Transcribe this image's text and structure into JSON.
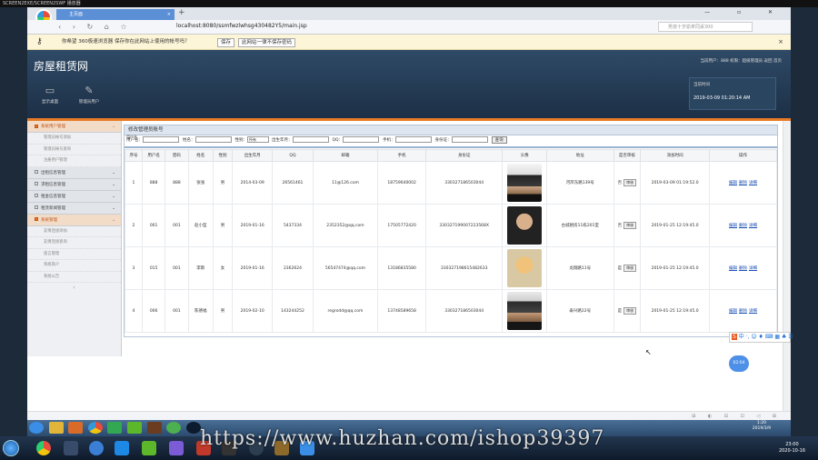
{
  "outer_title": "SCREEN2EXE/SCREEN2SWF 播放器",
  "browser": {
    "tab_label": "主页面",
    "tab_close": "×",
    "new_tab": "+",
    "nav_icons": "‹ › ↻ ⌂ ☆",
    "url": "localhost:8080/ssmfwzlwhsg430482Y5/main.jsp",
    "search_placeholder": "男孩十岁偷拿同桌300",
    "window_controls": "— ▫ ✕"
  },
  "infobar": {
    "text": "你希望 360极速浏览器 保存你在此网站上使用的帐号吗？",
    "save": "保存",
    "never": "此网站一律不保存密码",
    "close": "×"
  },
  "app": {
    "site_name": "房屋租赁网",
    "user_links": "当前用户：888 权限：超级管理员 返回 首页",
    "header_btns": [
      {
        "icon": "▭",
        "label": "显示桌面"
      },
      {
        "icon": "✎",
        "label": "管理员用户"
      }
    ],
    "time_label": "当前时间",
    "time_value": "2019-03-09 01:20:14 AM"
  },
  "sidebar": [
    {
      "label": "系统用户管理",
      "active": true,
      "items": [
        "管理员帐号添加",
        "管理员帐号查询",
        "注册用户管理"
      ]
    },
    {
      "label": "出租信息管理",
      "active": false,
      "items": []
    },
    {
      "label": "求租信息管理",
      "active": false,
      "items": []
    },
    {
      "label": "租金信息管理",
      "active": false,
      "items": []
    },
    {
      "label": "租赁新闻管理",
      "active": false,
      "items": []
    },
    {
      "label": "系统管理",
      "active": true,
      "items": [
        "友情连接添加",
        "友情连接查询",
        "留言管理",
        "系统简介",
        "系统公告"
      ]
    }
  ],
  "sidebar_collapse": "‹",
  "main": {
    "title": "修改管理员账号",
    "page_label": "用户名",
    "filters": [
      {
        "label": "用户名：",
        "type": "input"
      },
      {
        "label": "姓名：",
        "type": "input"
      },
      {
        "label": "性别：",
        "type": "select",
        "value": "所有"
      },
      {
        "label": "出生年月：",
        "type": "input"
      },
      {
        "label": "QQ：",
        "type": "input"
      },
      {
        "label": "手机：",
        "type": "input"
      },
      {
        "label": "身份证：",
        "type": "input"
      }
    ],
    "search_btn": "查询",
    "columns": [
      "序号",
      "用户名",
      "密码",
      "姓名",
      "性别",
      "出生年月",
      "QQ",
      "邮箱",
      "手机",
      "身份证",
      "头像",
      "地址",
      "是否审核",
      "添加时间",
      "操作"
    ],
    "rows": [
      {
        "no": "1",
        "user": "888",
        "pwd": "888",
        "name": "张张",
        "sex": "男",
        "birth": "2014-03-09",
        "qq": "26561461",
        "email": "11@126.com",
        "phone": "18759640002",
        "idcard": "330327186503044",
        "photo": "ph1",
        "addr": "河岸东路139号",
        "audit": "否",
        "time": "2019-03-09 01:19:52.0"
      },
      {
        "no": "2",
        "user": "001",
        "pwd": "001",
        "name": "赵小型",
        "sex": "男",
        "birth": "2019-01-16",
        "qq": "5437334",
        "email": "2352352@qq.com",
        "phone": "17505772420",
        "idcard": "330327199007223568X",
        "photo": "ph2",
        "addr": "古城厨房11栋201室",
        "audit": "否",
        "time": "2019-01-25 12:19:45.0"
      },
      {
        "no": "3",
        "user": "015",
        "pwd": "001",
        "name": "李斯",
        "sex": "女",
        "birth": "2019-01-16",
        "qq": "2362624",
        "email": "56547474@qq.com",
        "phone": "13186835580",
        "idcard": "330327198615482633",
        "photo": "ph3",
        "addr": "龙翔路11号",
        "audit": "是",
        "time": "2019-01-25 12:19:45.0"
      },
      {
        "no": "4",
        "user": "006",
        "pwd": "001",
        "name": "陈德福",
        "sex": "男",
        "birth": "2019-02-10",
        "qq": "143244252",
        "email": "regrodd@qq.com",
        "phone": "13748589658",
        "idcard": "330327186503044",
        "photo": "ph4",
        "addr": "泰兴路22号",
        "audit": "是",
        "time": "2019-01-25 12:19:45.0"
      }
    ],
    "audit_btn": "审核",
    "ops": [
      "编辑",
      "删除",
      "详细"
    ]
  },
  "ime": {
    "s": "S",
    "rest": "中 ·, ☺ ♦ ⌨ ▦ ♣ ☰"
  },
  "bubble": "02:04",
  "statusrow": "⊞ ◐ ⊟ ⊡ ◁ ⊞",
  "vm_clock": {
    "time": "1:20",
    "date": "2019/3/9"
  },
  "host_clock": {
    "time": "23:00",
    "date": "2020-10-16"
  },
  "watermark": "https://www.huzhan.com/ishop39397"
}
